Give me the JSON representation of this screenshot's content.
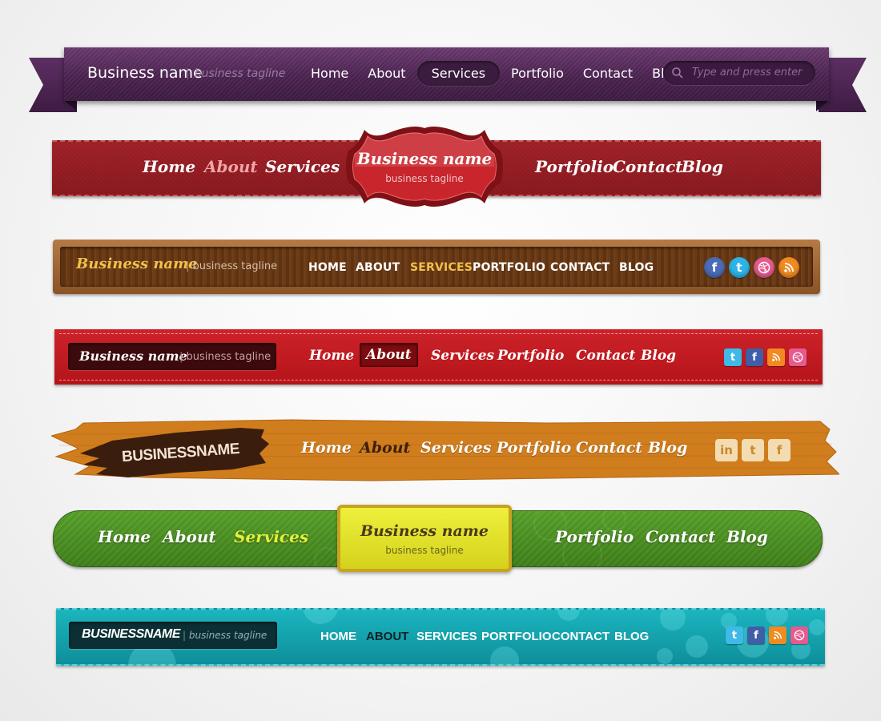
{
  "banner1": {
    "brand": "Business name",
    "tagline": "business tagline",
    "menu": [
      "Home",
      "About",
      "Services",
      "Portfolio",
      "Contact",
      "Blog"
    ],
    "active": "Services",
    "search_placeholder": "Type and press enter",
    "color": "#4b2350"
  },
  "banner2": {
    "brand": "Business name",
    "tagline": "business tagline",
    "menu_left": [
      "Home",
      "About",
      "Services"
    ],
    "menu_right": [
      "Portfolio",
      "Contact",
      "Blog"
    ],
    "active": "About",
    "color": "#96191f"
  },
  "banner3": {
    "brand": "Business name",
    "tagline": "business tagline",
    "menu": [
      "HOME",
      "ABOUT",
      "SERVICES",
      "PORTFOLIO",
      "CONTACT",
      "BLOG"
    ],
    "active": "SERVICES",
    "social": [
      "facebook-icon",
      "twitter-icon",
      "dribbble-icon",
      "rss-icon"
    ],
    "color": "#6a3b17"
  },
  "banner4": {
    "brand": "Business name",
    "tagline": "business tagline",
    "menu": [
      "Home",
      "About",
      "Services",
      "Portfolio",
      "Contact",
      "Blog"
    ],
    "active": "About",
    "social": [
      "twitter-icon",
      "facebook-icon",
      "rss-icon",
      "dribbble-icon"
    ],
    "color": "#c41b22"
  },
  "banner5": {
    "brand": "BUSINESSNAME",
    "menu": [
      "Home",
      "About",
      "Services",
      "Portfolio",
      "Contact",
      "Blog"
    ],
    "active": "About",
    "social": [
      "linkedin-icon",
      "twitter-icon",
      "facebook-icon"
    ],
    "color": "#d07d1e"
  },
  "banner6": {
    "brand": "Business name",
    "tagline": "business tagline",
    "menu_left": [
      "Home",
      "About",
      "Services"
    ],
    "menu_right": [
      "Portfolio",
      "Contact",
      "Blog"
    ],
    "active": "Services",
    "color": "#4a8f22"
  },
  "banner7": {
    "brand": "BUSINESSNAME",
    "tagline": "business tagline",
    "menu": [
      "HOME",
      "ABOUT",
      "SERVICES",
      "PORTFOLIO",
      "CONTACT",
      "BLOG"
    ],
    "active": "ABOUT",
    "social": [
      "twitter-icon",
      "facebook-icon",
      "rss-icon",
      "dribbble-icon"
    ],
    "color": "#15a3ae"
  }
}
